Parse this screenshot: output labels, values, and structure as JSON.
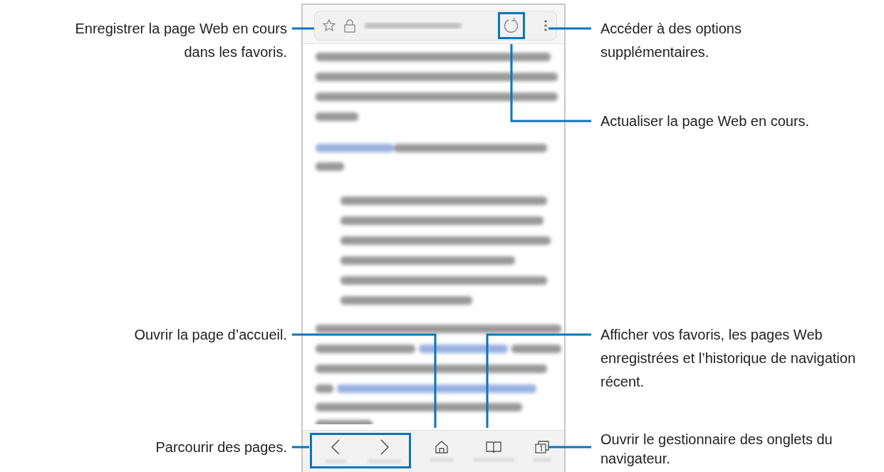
{
  "callouts": [
    {
      "text": "Enregistrer la page Web en cours dans les favoris."
    },
    {
      "text": "Accéder à des options supplémentaires."
    },
    {
      "text": "Actualiser la page Web en cours."
    },
    {
      "text": "Ouvrir la page d’accueil."
    },
    {
      "text": "Afficher vos favoris, les pages Web enregistrées et l’historique de navigation récent."
    },
    {
      "text": "Parcourir des pages."
    },
    {
      "text": "Ouvrir le gestionnaire des onglets du navigateur."
    }
  ]
}
